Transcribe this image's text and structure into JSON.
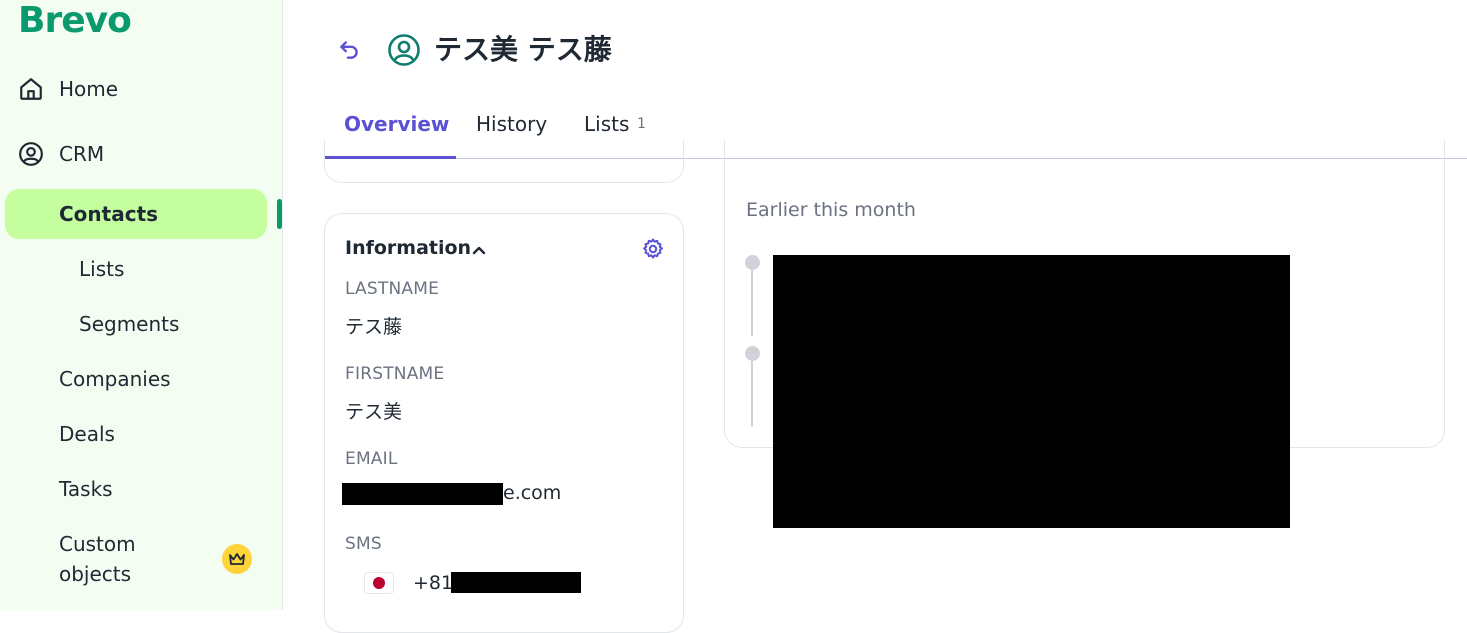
{
  "app": {
    "logo": "Brevo"
  },
  "sidebar": {
    "home": "Home",
    "crm": "CRM",
    "contacts": "Contacts",
    "lists": "Lists",
    "segments": "Segments",
    "companies": "Companies",
    "deals": "Deals",
    "tasks": "Tasks",
    "custom_objects_line1": "Custom",
    "custom_objects_line2": "objects"
  },
  "header": {
    "contact_name": "テス美 テス藤"
  },
  "tabs": {
    "overview": "Overview",
    "history": "History",
    "lists": "Lists",
    "lists_count": "1"
  },
  "info": {
    "title": "Information",
    "lastname_label": "LASTNAME",
    "lastname_value": "テス藤",
    "firstname_label": "FIRSTNAME",
    "firstname_value": "テス美",
    "email_label": "EMAIL",
    "email_visible_suffix": "e.com",
    "sms_label": "SMS",
    "sms_prefix": "+81"
  },
  "timeline": {
    "section_title": "Earlier this month"
  },
  "colors": {
    "brand_green": "#0b996e",
    "active_bg": "#c4fe9f",
    "accent_purple": "#5b51d4"
  }
}
